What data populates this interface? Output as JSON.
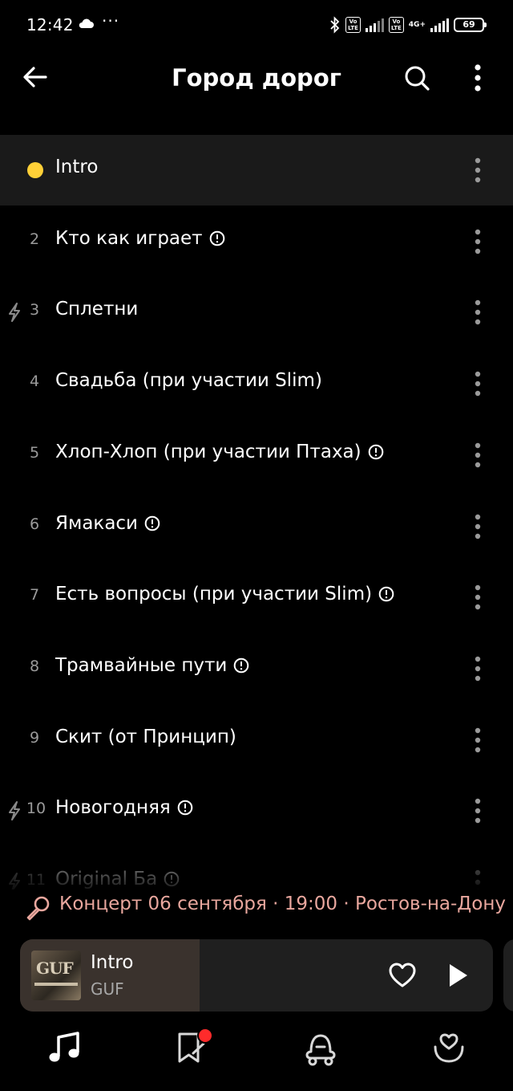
{
  "status_bar": {
    "time": "12:42",
    "extra": "···",
    "network_1": "Vo LTE",
    "network_2": "Vo LTE",
    "network_type": "4G+",
    "battery": "69"
  },
  "header": {
    "title": "Город дорог",
    "back_icon": "arrow-left-icon",
    "search_icon": "search-icon",
    "more_icon": "more-vertical-icon"
  },
  "tracks": [
    {
      "number": "",
      "title": "Intro",
      "explicit": false,
      "downloaded": false,
      "playing": true
    },
    {
      "number": "2",
      "title": "Кто как играет",
      "explicit": true,
      "downloaded": false,
      "playing": false
    },
    {
      "number": "3",
      "title": "Сплетни",
      "explicit": false,
      "downloaded": true,
      "playing": false
    },
    {
      "number": "4",
      "title": "Свадьба (при участии Slim)",
      "explicit": false,
      "downloaded": false,
      "playing": false
    },
    {
      "number": "5",
      "title": "Хлоп-Хлоп (при участии Птаха)",
      "explicit": true,
      "downloaded": false,
      "playing": false
    },
    {
      "number": "6",
      "title": "Ямакаси",
      "explicit": true,
      "downloaded": false,
      "playing": false
    },
    {
      "number": "7",
      "title": "Есть вопросы (при участии  Slim)",
      "explicit": true,
      "downloaded": false,
      "playing": false
    },
    {
      "number": "8",
      "title": "Трамвайные пути",
      "explicit": true,
      "downloaded": false,
      "playing": false
    },
    {
      "number": "9",
      "title": "Скит (от Принцип)",
      "explicit": false,
      "downloaded": false,
      "playing": false
    },
    {
      "number": "10",
      "title": "Новогодняя",
      "explicit": true,
      "downloaded": true,
      "playing": false
    },
    {
      "number": "11",
      "title": "Original Ба",
      "explicit": true,
      "downloaded": true,
      "playing": false
    }
  ],
  "concert": {
    "text": "Концерт 06 сентября · 19:00 · Ростов-на-Дону",
    "icon": "microphone-icon"
  },
  "mini_player": {
    "title": "Intro",
    "artist": "GUF",
    "cover_text": "GUF",
    "progress": 0.38
  },
  "bottom_nav": [
    {
      "name": "music",
      "icon": "music-note-icon",
      "active": true
    },
    {
      "name": "podcasts",
      "icon": "book-icon",
      "active": false,
      "badge": true
    },
    {
      "name": "kids",
      "icon": "kids-icon",
      "active": false
    },
    {
      "name": "collection",
      "icon": "heart-icon",
      "active": false
    }
  ],
  "colors": {
    "background": "#000000",
    "accent_dot": "#ffd037",
    "concert_text": "#e9a79e",
    "badge": "#ff2b2b"
  }
}
